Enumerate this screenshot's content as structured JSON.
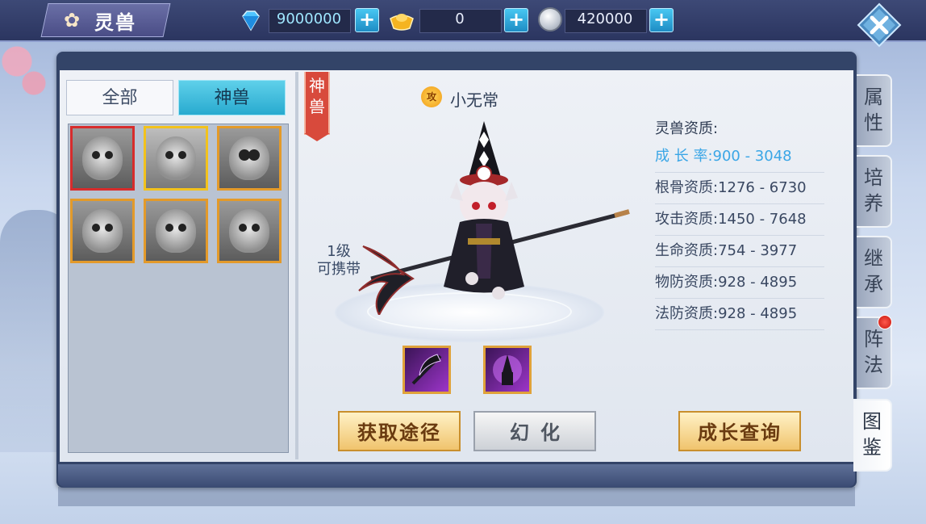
{
  "header": {
    "title": "灵兽",
    "diamond": "9000000",
    "gold_ingot": "0",
    "silver": "420000",
    "plus_label": "+"
  },
  "filters": {
    "all": "全部",
    "beast": "神兽"
  },
  "pets": [
    {
      "name": "bear"
    },
    {
      "name": "xiao-wu-chang"
    },
    {
      "name": "panda"
    },
    {
      "name": "monkey"
    },
    {
      "name": "rabbit"
    },
    {
      "name": "fox"
    }
  ],
  "display": {
    "ribbon": "神兽",
    "rank": "攻",
    "name": "小无常",
    "level_line1": "1级",
    "level_line2": "可携带"
  },
  "stats": {
    "title": "灵兽资质:",
    "growth": "成 长 率:900 - 3048",
    "rows": [
      "根骨资质:1276 - 6730",
      "攻击资质:1450 - 7648",
      "生命资质:754   - 3977",
      "物防资质:928   - 4895",
      "法防资质:928   - 4895"
    ]
  },
  "buttons": {
    "obtain": "获取途径",
    "transform": "幻化",
    "growth_query": "成长查询"
  },
  "side_tabs": {
    "attributes": "属性",
    "train": "培养",
    "inherit": "继承",
    "formation": "阵法",
    "catalog": "图鉴"
  },
  "colors": {
    "growth_text": "#3aa6e6",
    "selected_border": "#d72c2c",
    "active_tab": "#28aacf"
  }
}
